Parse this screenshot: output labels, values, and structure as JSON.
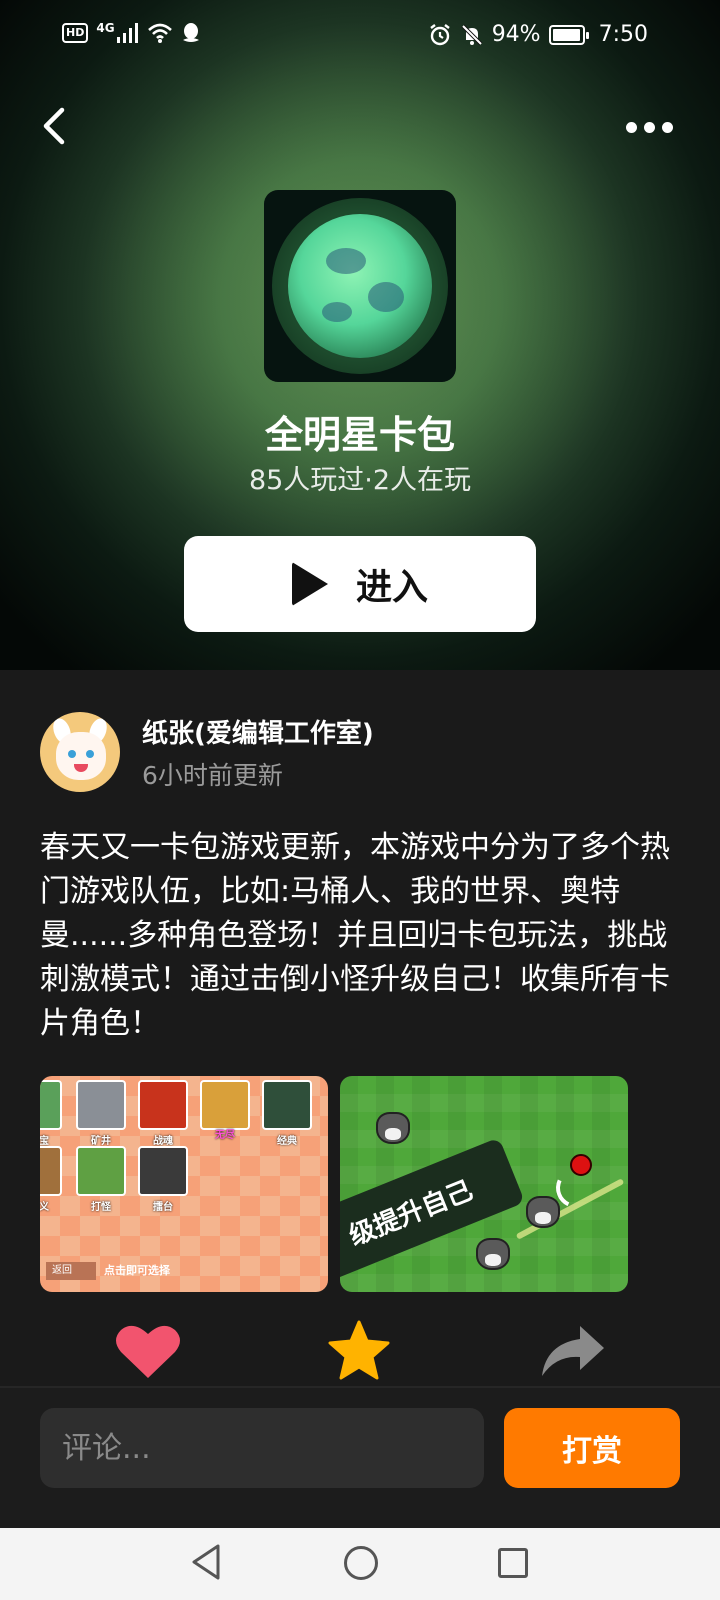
{
  "status_bar": {
    "hd": "HD",
    "network": "4G",
    "battery": "94%",
    "time": "7:50"
  },
  "game": {
    "title": "全明星卡包",
    "stats": "85人玩过·2人在玩",
    "enter_label": "进入"
  },
  "author": {
    "name": "纸张(爱编辑工作室)",
    "updated": "6小时前更新"
  },
  "description": "春天又一卡包游戏更新，本游戏中分为了多个热门游戏队伍，比如:马桶人、我的世界、奥特曼......多种角色登场！并且回归卡包玩法，挑战刺激模式！通过击倒小怪升级自己！收集所有卡片角色！",
  "screenshots": {
    "shot1": {
      "cards": [
        "矿井",
        "战魂",
        "无尽",
        "经典",
        "打怪",
        "擂台"
      ],
      "partial_labels": [
        "宝",
        "义"
      ],
      "back": "返回",
      "tip": "点击即可选择"
    },
    "shot2": {
      "banner": "级提升自己"
    }
  },
  "actions": {
    "like_icon": "heart-icon",
    "favorite_icon": "star-icon",
    "share_icon": "share-arrow-icon",
    "like_color": "#f2546e",
    "favorite_color": "#ffb300",
    "share_color": "#8a8a8a"
  },
  "comment": {
    "placeholder": "评论...",
    "tip_label": "打赏"
  },
  "colors": {
    "accent": "#ff7a00",
    "background": "#1a1a1a"
  }
}
